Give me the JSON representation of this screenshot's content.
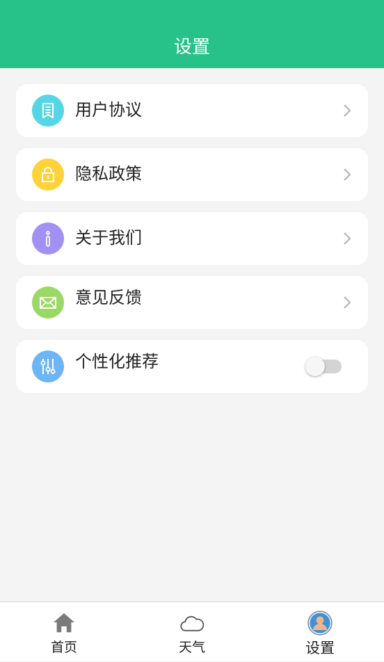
{
  "header": {
    "title": "设置"
  },
  "settings": {
    "items": [
      {
        "label": "用户协议",
        "icon": "document-icon",
        "color": "#56d6e4"
      },
      {
        "label": "隐私政策",
        "icon": "lock-icon",
        "color": "#fdd23a"
      },
      {
        "label": "关于我们",
        "icon": "info-icon",
        "color": "#a290f3"
      },
      {
        "label": "意见反馈",
        "icon": "mail-icon",
        "color": "#9ad964"
      },
      {
        "label": "个性化推荐",
        "icon": "sliders-icon",
        "color": "#6db5f4",
        "toggle": false
      }
    ]
  },
  "tabbar": {
    "tabs": [
      {
        "label": "首页",
        "icon": "home-icon"
      },
      {
        "label": "天气",
        "icon": "cloud-icon"
      },
      {
        "label": "设置",
        "icon": "avatar-icon",
        "active": true
      }
    ]
  },
  "colors": {
    "brand": "#26c28a",
    "background": "#f4f4f4"
  }
}
